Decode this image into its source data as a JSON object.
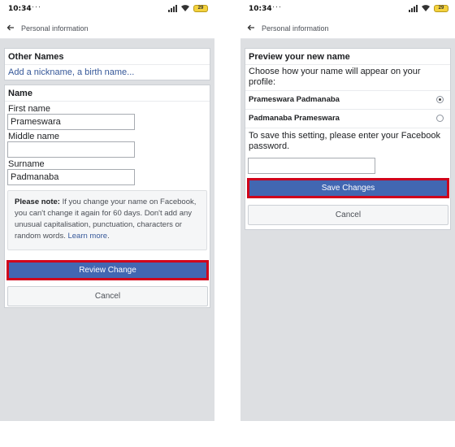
{
  "status_bar": {
    "time": "10:34",
    "dots": "···",
    "battery": "29"
  },
  "left_screen": {
    "header_title": "Personal information",
    "other_names": {
      "title": "Other Names",
      "add_link": "Add a nickname, a birth name..."
    },
    "name_section": {
      "title": "Name",
      "first_name_label": "First name",
      "first_name_value": "Prameswara",
      "middle_name_label": "Middle name",
      "middle_name_value": "",
      "surname_label": "Surname",
      "surname_value": "Padmanaba"
    },
    "note": {
      "bold": "Please note:",
      "text": " If you change your name on Facebook, you can't change it again for 60 days. Don't add any unusual capitalisation, punctuation, characters or random words. ",
      "link": "Learn more",
      "suffix": "."
    },
    "review_button": "Review Change",
    "cancel_button": "Cancel"
  },
  "right_screen": {
    "header_title": "Personal information",
    "preview_title": "Preview your new name",
    "description": "Choose how your name will appear on your profile:",
    "options": [
      {
        "label": "Prameswara Padmanaba",
        "selected": true
      },
      {
        "label": "Padmanaba Prameswara",
        "selected": false
      }
    ],
    "password_prompt": "To save this setting, please enter your Facebook password.",
    "password_value": "",
    "save_button": "Save Changes",
    "cancel_button": "Cancel"
  },
  "colors": {
    "primary": "#4267b2",
    "highlight": "#d0021b",
    "link": "#365899",
    "page_background": "#dddfe2"
  }
}
